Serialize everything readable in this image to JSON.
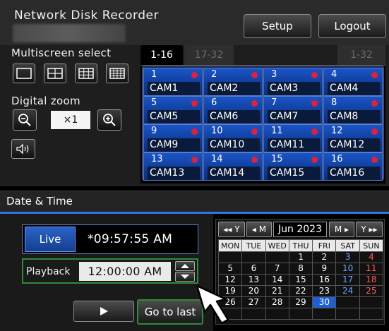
{
  "header": {
    "title": "Network Disk Recorder",
    "setup_label": "Setup",
    "logout_label": "Logout"
  },
  "multiscreen": {
    "label": "Multiscreen select",
    "modes": [
      "single-screen-icon",
      "quad-screen-icon",
      "nine-screen-icon",
      "sixteen-screen-icon"
    ]
  },
  "digital_zoom": {
    "label": "Digital zoom",
    "value": "×1"
  },
  "tabs": [
    "1-16",
    "17-32",
    "1-32"
  ],
  "cameras": [
    {
      "num": "1",
      "name": "CAM1"
    },
    {
      "num": "2",
      "name": "CAM2"
    },
    {
      "num": "3",
      "name": "CAM3"
    },
    {
      "num": "4",
      "name": "CAM4"
    },
    {
      "num": "5",
      "name": "CAM5"
    },
    {
      "num": "6",
      "name": "CAM6"
    },
    {
      "num": "7",
      "name": "CAM7"
    },
    {
      "num": "8",
      "name": "CAM8"
    },
    {
      "num": "9",
      "name": "CAM9"
    },
    {
      "num": "10",
      "name": "CAM10"
    },
    {
      "num": "11",
      "name": "CAM11"
    },
    {
      "num": "12",
      "name": "CAM12"
    },
    {
      "num": "13",
      "name": "CAM13"
    },
    {
      "num": "14",
      "name": "CAM14"
    },
    {
      "num": "15",
      "name": "CAM15"
    },
    {
      "num": "16",
      "name": "CAM16"
    }
  ],
  "datetime": {
    "label": "Date & Time",
    "live_label": "Live",
    "live_time": "*09:57:55 AM",
    "playback_label": "Playback",
    "playback_time": "12:00:00 AM",
    "go_to_last_label": "Go to last"
  },
  "calendar": {
    "prev_year": "◂◂ Y",
    "prev_month": "◂ M",
    "month": "Jun 2023",
    "next_month": "M ▸",
    "next_year": "Y ▸▸",
    "weekdays": [
      "MON",
      "TUE",
      "WED",
      "THU",
      "FRI",
      "SAT",
      "SUN"
    ],
    "weeks": [
      [
        "",
        "",
        "",
        "1",
        "2",
        "3",
        "4"
      ],
      [
        "5",
        "6",
        "7",
        "8",
        "9",
        "10",
        "11"
      ],
      [
        "12",
        "13",
        "14",
        "15",
        "16",
        "17",
        "18"
      ],
      [
        "19",
        "20",
        "21",
        "22",
        "23",
        "24",
        "25"
      ],
      [
        "26",
        "27",
        "28",
        "29",
        "30",
        "",
        ""
      ],
      [
        "",
        "",
        "",
        "",
        "",
        "",
        ""
      ]
    ],
    "selected_day": "30"
  },
  "colors": {
    "accent_blue": "#1f5fd0",
    "record_dot": "#e0203c",
    "active_border_green": "#2f8a3a"
  }
}
